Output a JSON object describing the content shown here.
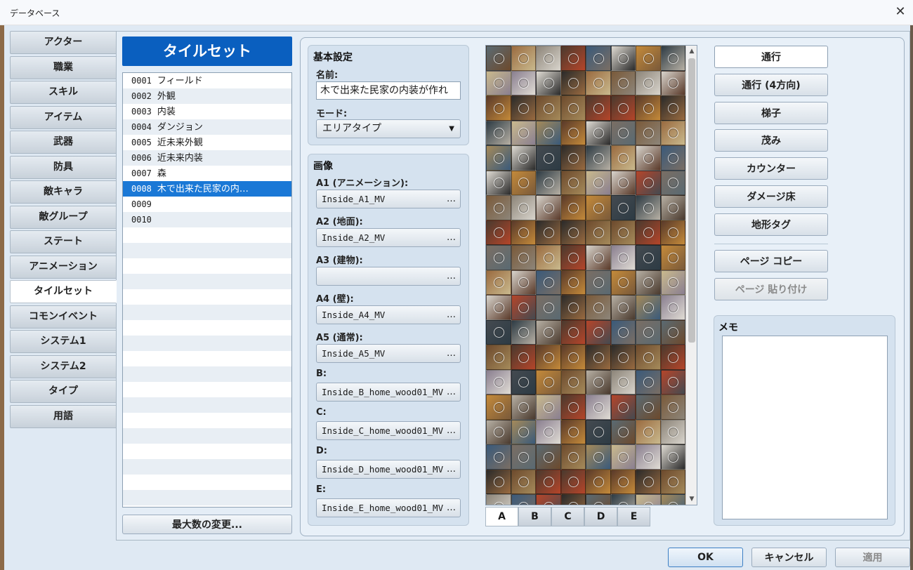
{
  "window": {
    "title": "データベース",
    "close": "✕"
  },
  "categories": [
    {
      "label": "アクター"
    },
    {
      "label": "職業"
    },
    {
      "label": "スキル"
    },
    {
      "label": "アイテム"
    },
    {
      "label": "武器"
    },
    {
      "label": "防具"
    },
    {
      "label": "敵キャラ"
    },
    {
      "label": "敵グループ"
    },
    {
      "label": "ステート"
    },
    {
      "label": "アニメーション"
    },
    {
      "label": "タイルセット",
      "active": true
    },
    {
      "label": "コモンイベント"
    },
    {
      "label": "システム1"
    },
    {
      "label": "システム2"
    },
    {
      "label": "タイプ"
    },
    {
      "label": "用語"
    }
  ],
  "list": {
    "header": "タイルセット",
    "items": [
      {
        "id": "0001",
        "name": "フィールド"
      },
      {
        "id": "0002",
        "name": "外観"
      },
      {
        "id": "0003",
        "name": "内装"
      },
      {
        "id": "0004",
        "name": "ダンジョン"
      },
      {
        "id": "0005",
        "name": "近未来外観"
      },
      {
        "id": "0006",
        "name": "近未来内装"
      },
      {
        "id": "0007",
        "name": "森"
      },
      {
        "id": "0008",
        "name": "木で出来た民家の内…",
        "selected": true
      },
      {
        "id": "0009",
        "name": ""
      },
      {
        "id": "0010",
        "name": ""
      }
    ],
    "max_button": "最大数の変更..."
  },
  "basic": {
    "title": "基本設定",
    "name_label": "名前:",
    "name_value": "木で出来た民家の内装が作れ",
    "mode_label": "モード:",
    "mode_value": "エリアタイプ"
  },
  "images": {
    "title": "画像",
    "fields": [
      {
        "label": "A1 (アニメーション):",
        "value": "Inside_A1_MV"
      },
      {
        "label": "A2 (地面):",
        "value": "Inside_A2_MV"
      },
      {
        "label": "A3 (建物):",
        "value": ""
      },
      {
        "label": "A4 (壁):",
        "value": "Inside_A4_MV"
      },
      {
        "label": "A5 (通常):",
        "value": "Inside_A5_MV"
      },
      {
        "label": "B:",
        "value": "Inside_B_home_wood01_MV"
      },
      {
        "label": "C:",
        "value": "Inside_C_home_wood01_MV"
      },
      {
        "label": "D:",
        "value": "Inside_D_home_wood01_MV"
      },
      {
        "label": "E:",
        "value": "Inside_E_home_wood01_MV"
      }
    ],
    "dots": "…"
  },
  "tile_tabs": [
    {
      "label": "A",
      "active": true
    },
    {
      "label": "B"
    },
    {
      "label": "C"
    },
    {
      "label": "D"
    },
    {
      "label": "E"
    }
  ],
  "scroll": {
    "up": "▲",
    "down": "▼"
  },
  "tile_palette": [
    "#5a6a72",
    "#2d3b44",
    "#7a5a3a",
    "#9a6b40",
    "#6d4a2d",
    "#b7b0a4",
    "#8d8579",
    "#c9b98d",
    "#a58a5a",
    "#4a3a2e",
    "#d8d4cc",
    "#8a7f90",
    "#3a5a7a",
    "#b5452a",
    "#5a3a2a",
    "#e0dcd4",
    "#7a6e64",
    "#444a50",
    "#c48a3a",
    "#2a2a2a"
  ],
  "tool_buttons": [
    {
      "label": "通行",
      "selected": true
    },
    {
      "label": "通行 (4方向)"
    },
    {
      "label": "梯子"
    },
    {
      "label": "茂み"
    },
    {
      "label": "カウンター"
    },
    {
      "label": "ダメージ床"
    },
    {
      "label": "地形タグ"
    }
  ],
  "page_buttons": [
    {
      "label": "ページ コピー"
    },
    {
      "label": "ページ 貼り付け",
      "disabled": true
    }
  ],
  "memo": {
    "title": "メモ",
    "value": ""
  },
  "footer": {
    "ok": "OK",
    "cancel": "キャンセル",
    "apply": "適用"
  }
}
